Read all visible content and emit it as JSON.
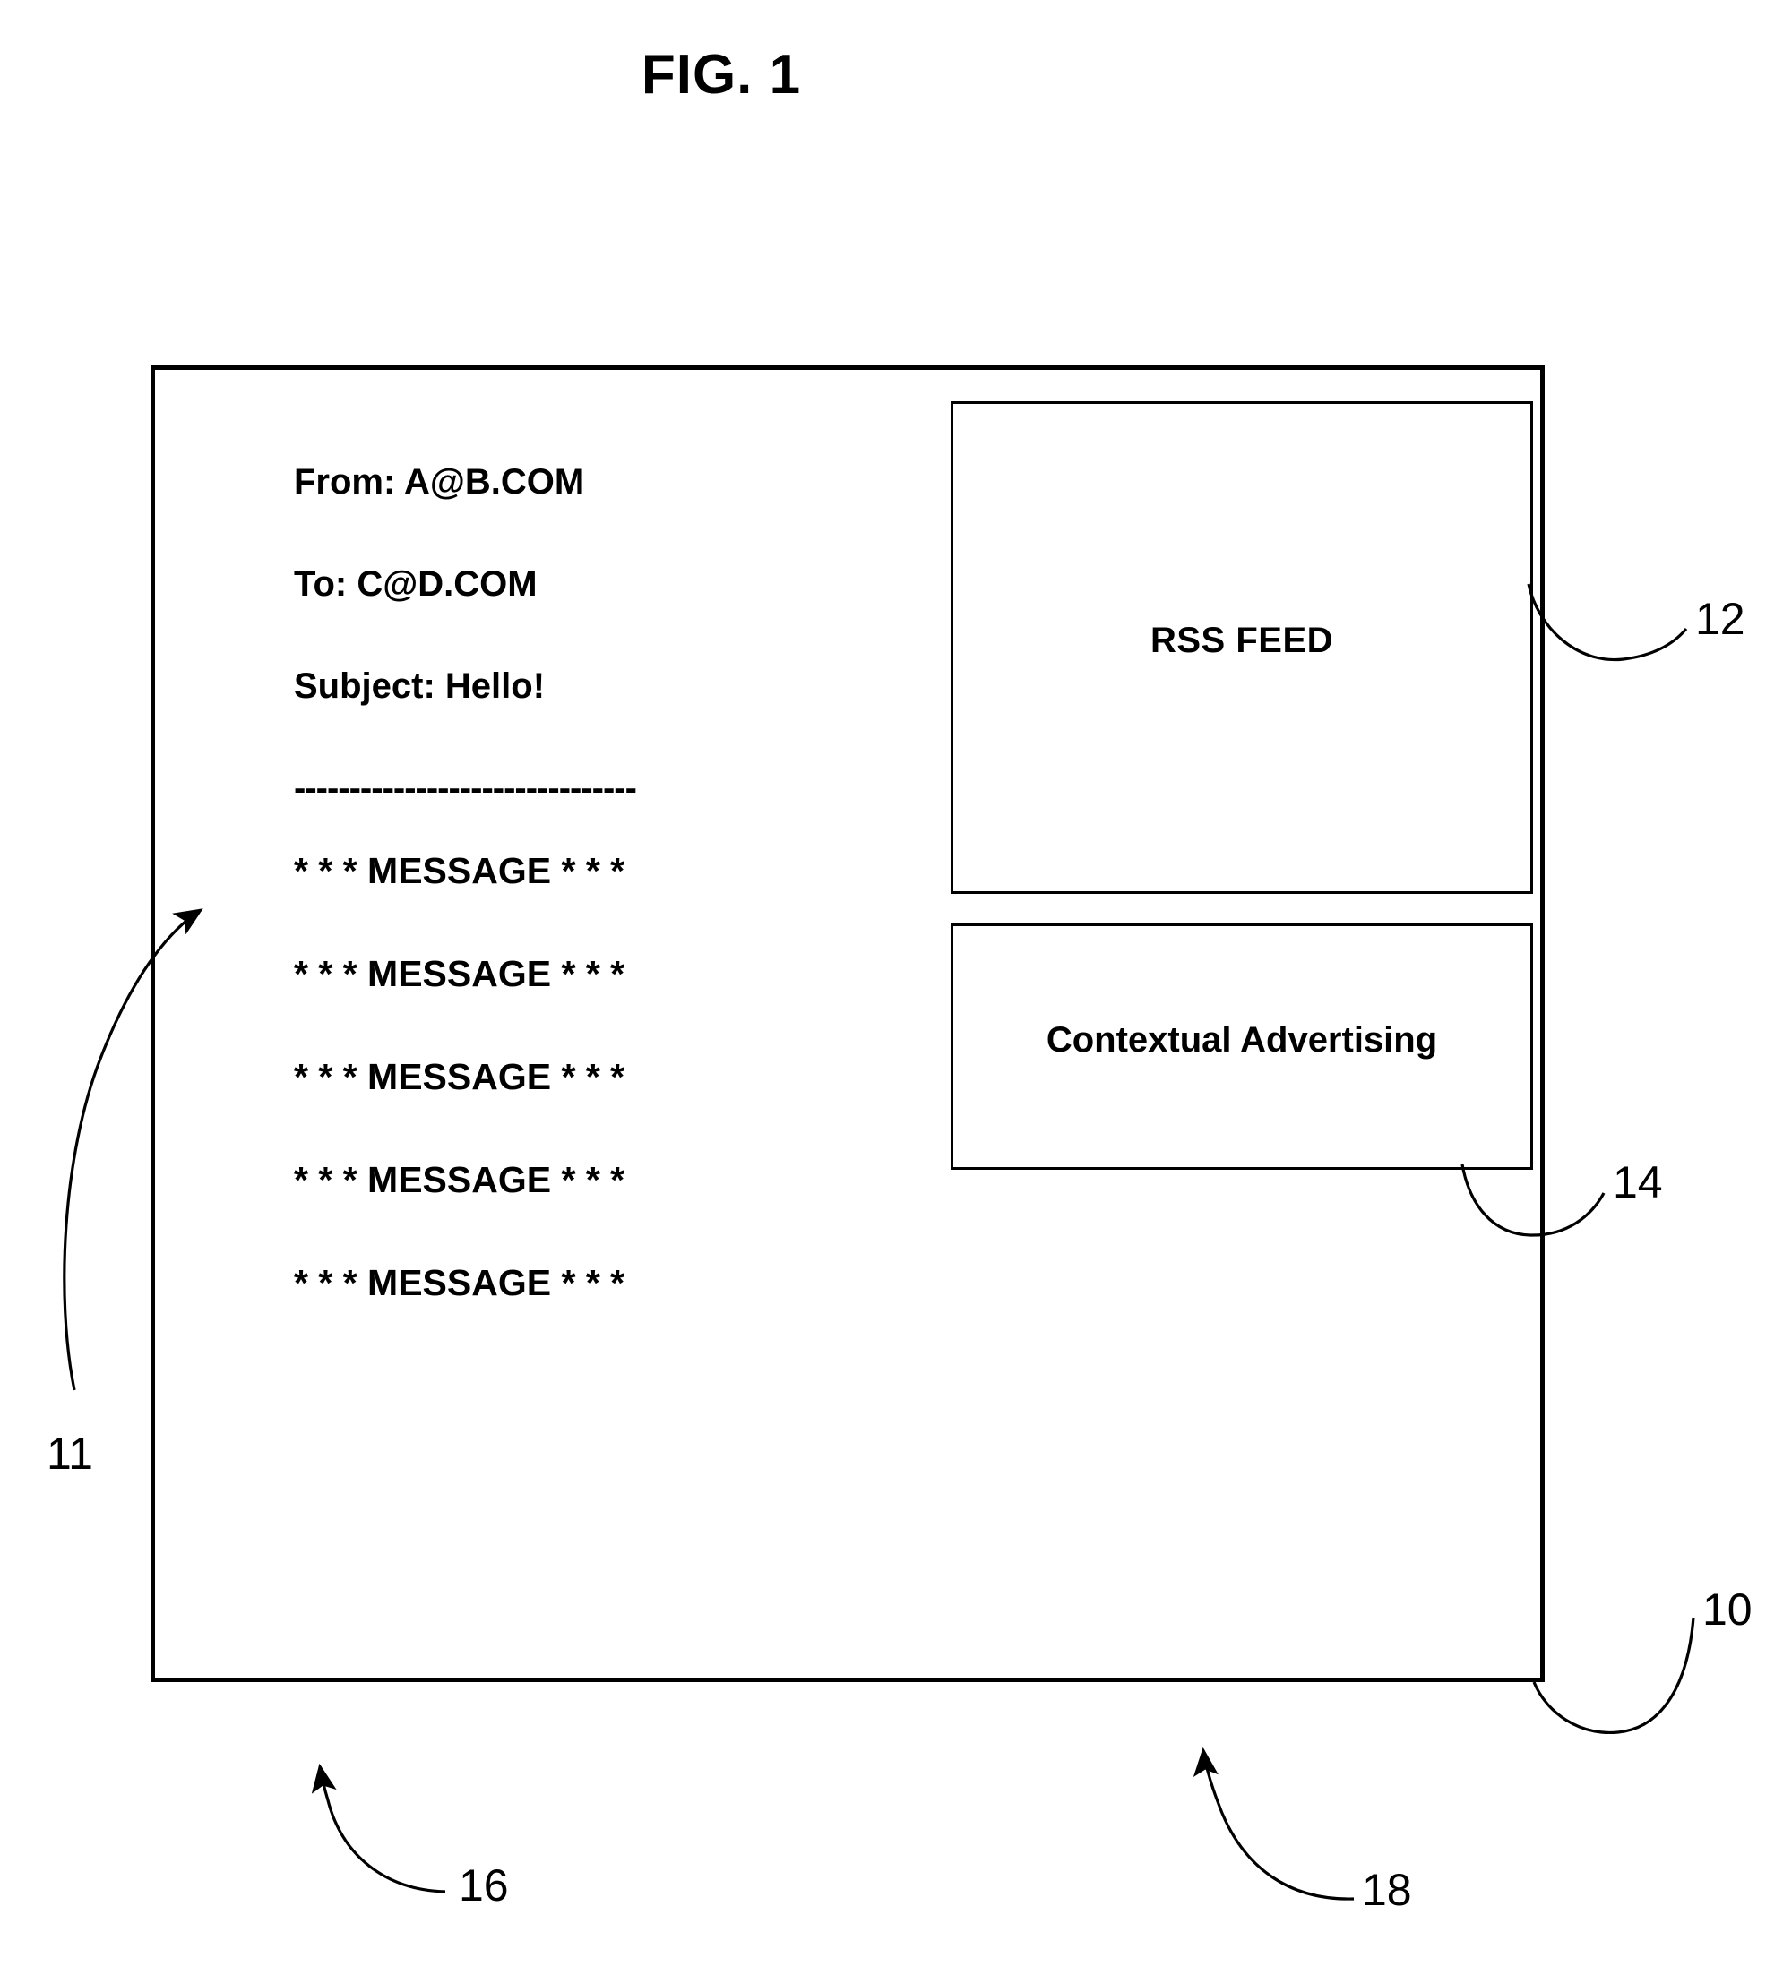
{
  "figure": {
    "title": "FIG. 1"
  },
  "email_pane": {
    "headers": [
      {
        "label": "From: A@B.COM"
      },
      {
        "label": "To: C@D.COM"
      },
      {
        "label": "Subject: Hello!"
      }
    ],
    "separator": "----------------------------------------",
    "message_lines": [
      {
        "text": "* * * MESSAGE * * *"
      },
      {
        "text": "* * * MESSAGE * * *"
      },
      {
        "text": "* * * MESSAGE * * *"
      },
      {
        "text": "* * * MESSAGE * * *"
      },
      {
        "text": "* * * MESSAGE * * *"
      }
    ]
  },
  "rss_panel": {
    "label": "RSS FEED"
  },
  "ad_panel": {
    "label": "Contextual Advertising"
  },
  "reference_numerals": {
    "window": "10",
    "email_message": "11",
    "rss_feed": "12",
    "contextual_advertising": "14",
    "email_region": "16",
    "feed_region": "18"
  },
  "colors": {
    "line": "#000000",
    "background": "#ffffff"
  }
}
